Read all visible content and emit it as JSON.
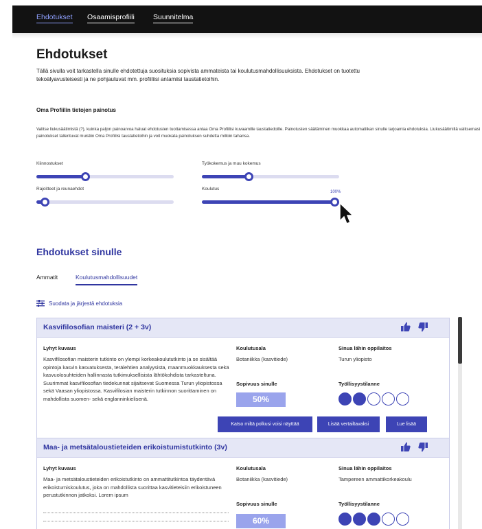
{
  "nav": {
    "items": [
      "Ehdotukset",
      "Osaamisprofiili",
      "Suunnitelma"
    ]
  },
  "page": {
    "title": "Ehdotukset",
    "intro": "Tällä sivulla voit tarkastella sinulle ehdotettuja suosituksia sopivista ammateista tai koulutusmahdollisuuksista. Ehdotukset on tuotettu tekoälyavusteisesti ja ne pohjautuvat mm. profiiliisi antamiisi taustatietoihin."
  },
  "weighting": {
    "title": "Oma Profiilin tietojen painotus",
    "description": "Valitse liukusäätimistä (?), kuinka paljon painoarvoa haluat ehdotusten tuottamisessa antaa Oma Profiilisi kuvaamille taustatiedoille. Painotusten säätäminen muokkaa automatiikan sinulle tarjoamia ehdotuksia. Liukusäätimillä valitsemasi painotukset tallentuvat muistiin Oma Profiilisi taustatietoihin ja voit muokata painotuksen suhdetta milloin tahansa.",
    "sliders": [
      {
        "label": "Kiinnostukset",
        "value": 0.35
      },
      {
        "label": "Työkokemus ja muu kokemus",
        "value": 0.33
      },
      {
        "label": "Rajoitteet ja reunaehdot",
        "value": 0.03
      },
      {
        "label": "Koulutus",
        "value": 1.0,
        "value_label": "100%"
      }
    ]
  },
  "suggestions": {
    "title": "Ehdotukset sinulle",
    "tabs": [
      "Ammatit",
      "Koulutusmahdollisuudet"
    ],
    "active_tab": "Koulutusmahdollisuudet",
    "filter_label": "Suodata ja järjestä ehdotuksia"
  },
  "labels": {
    "short_description": "Lyhyt kuvaus",
    "field": "Koulutusala",
    "nearest_institution": "Sinua lähin oppilaitos",
    "fit": "Sopivuus sinulle",
    "employment": "Työllisyystilanne"
  },
  "cards": [
    {
      "title": "Kasvifilosofian maisteri (2 + 3v)",
      "description": "Kasvifilosofian maisterin tutkinto on ylempi korkeakoulututkinto ja se sisältää opintoja kasvin kasvatuksesta, terälehtien analyysista, maanmuokkauksesta sekä kasvuolosuhteiden hallinnasta tutkimuksellisista lähtökohdista tarkasteltuna. Suurimmat kasvifilosofian tiedekunnat sijaitsevat Suomessa Turun yliopistossa sekä Vaasan yliopistossa. Kasvifilosian maisterin tutkinnon suorittaminen on mahdollista suomen- sekä englanninkielisenä.",
      "field": "Botaniikka (kasvitiede)",
      "institution": "Turun yliopisto",
      "fit": "50%",
      "employment_level": 2,
      "employment_max": 5,
      "buttons": [
        "Katso miltä polkusi voisi näyttää",
        "Lisää vertailtavaksi",
        "Lue lisää"
      ]
    },
    {
      "title": "Maa- ja metsätaloustieteiden erikoistumistutkinto (3v)",
      "description": "Maa- ja metsätaloustieteiden erikoistutkinto on ammattitutkintoa täydentävä erikoistumiskoulutus, joka on mahdollista suorittaa kasvitieteisiin erikoistuneen perustutkinnon jatkoksi. Lorem ipsum",
      "field": "Botaniikka (kasvitiede)",
      "institution": "Tampereen ammattikorkeakoulu",
      "fit": "60%",
      "employment_level": 3,
      "employment_max": 5
    }
  ],
  "colors": {
    "accent": "#3d44b5",
    "accent_light": "#9aa4ec",
    "card_header": "#e5e7f6",
    "nav_bg": "#121212"
  }
}
